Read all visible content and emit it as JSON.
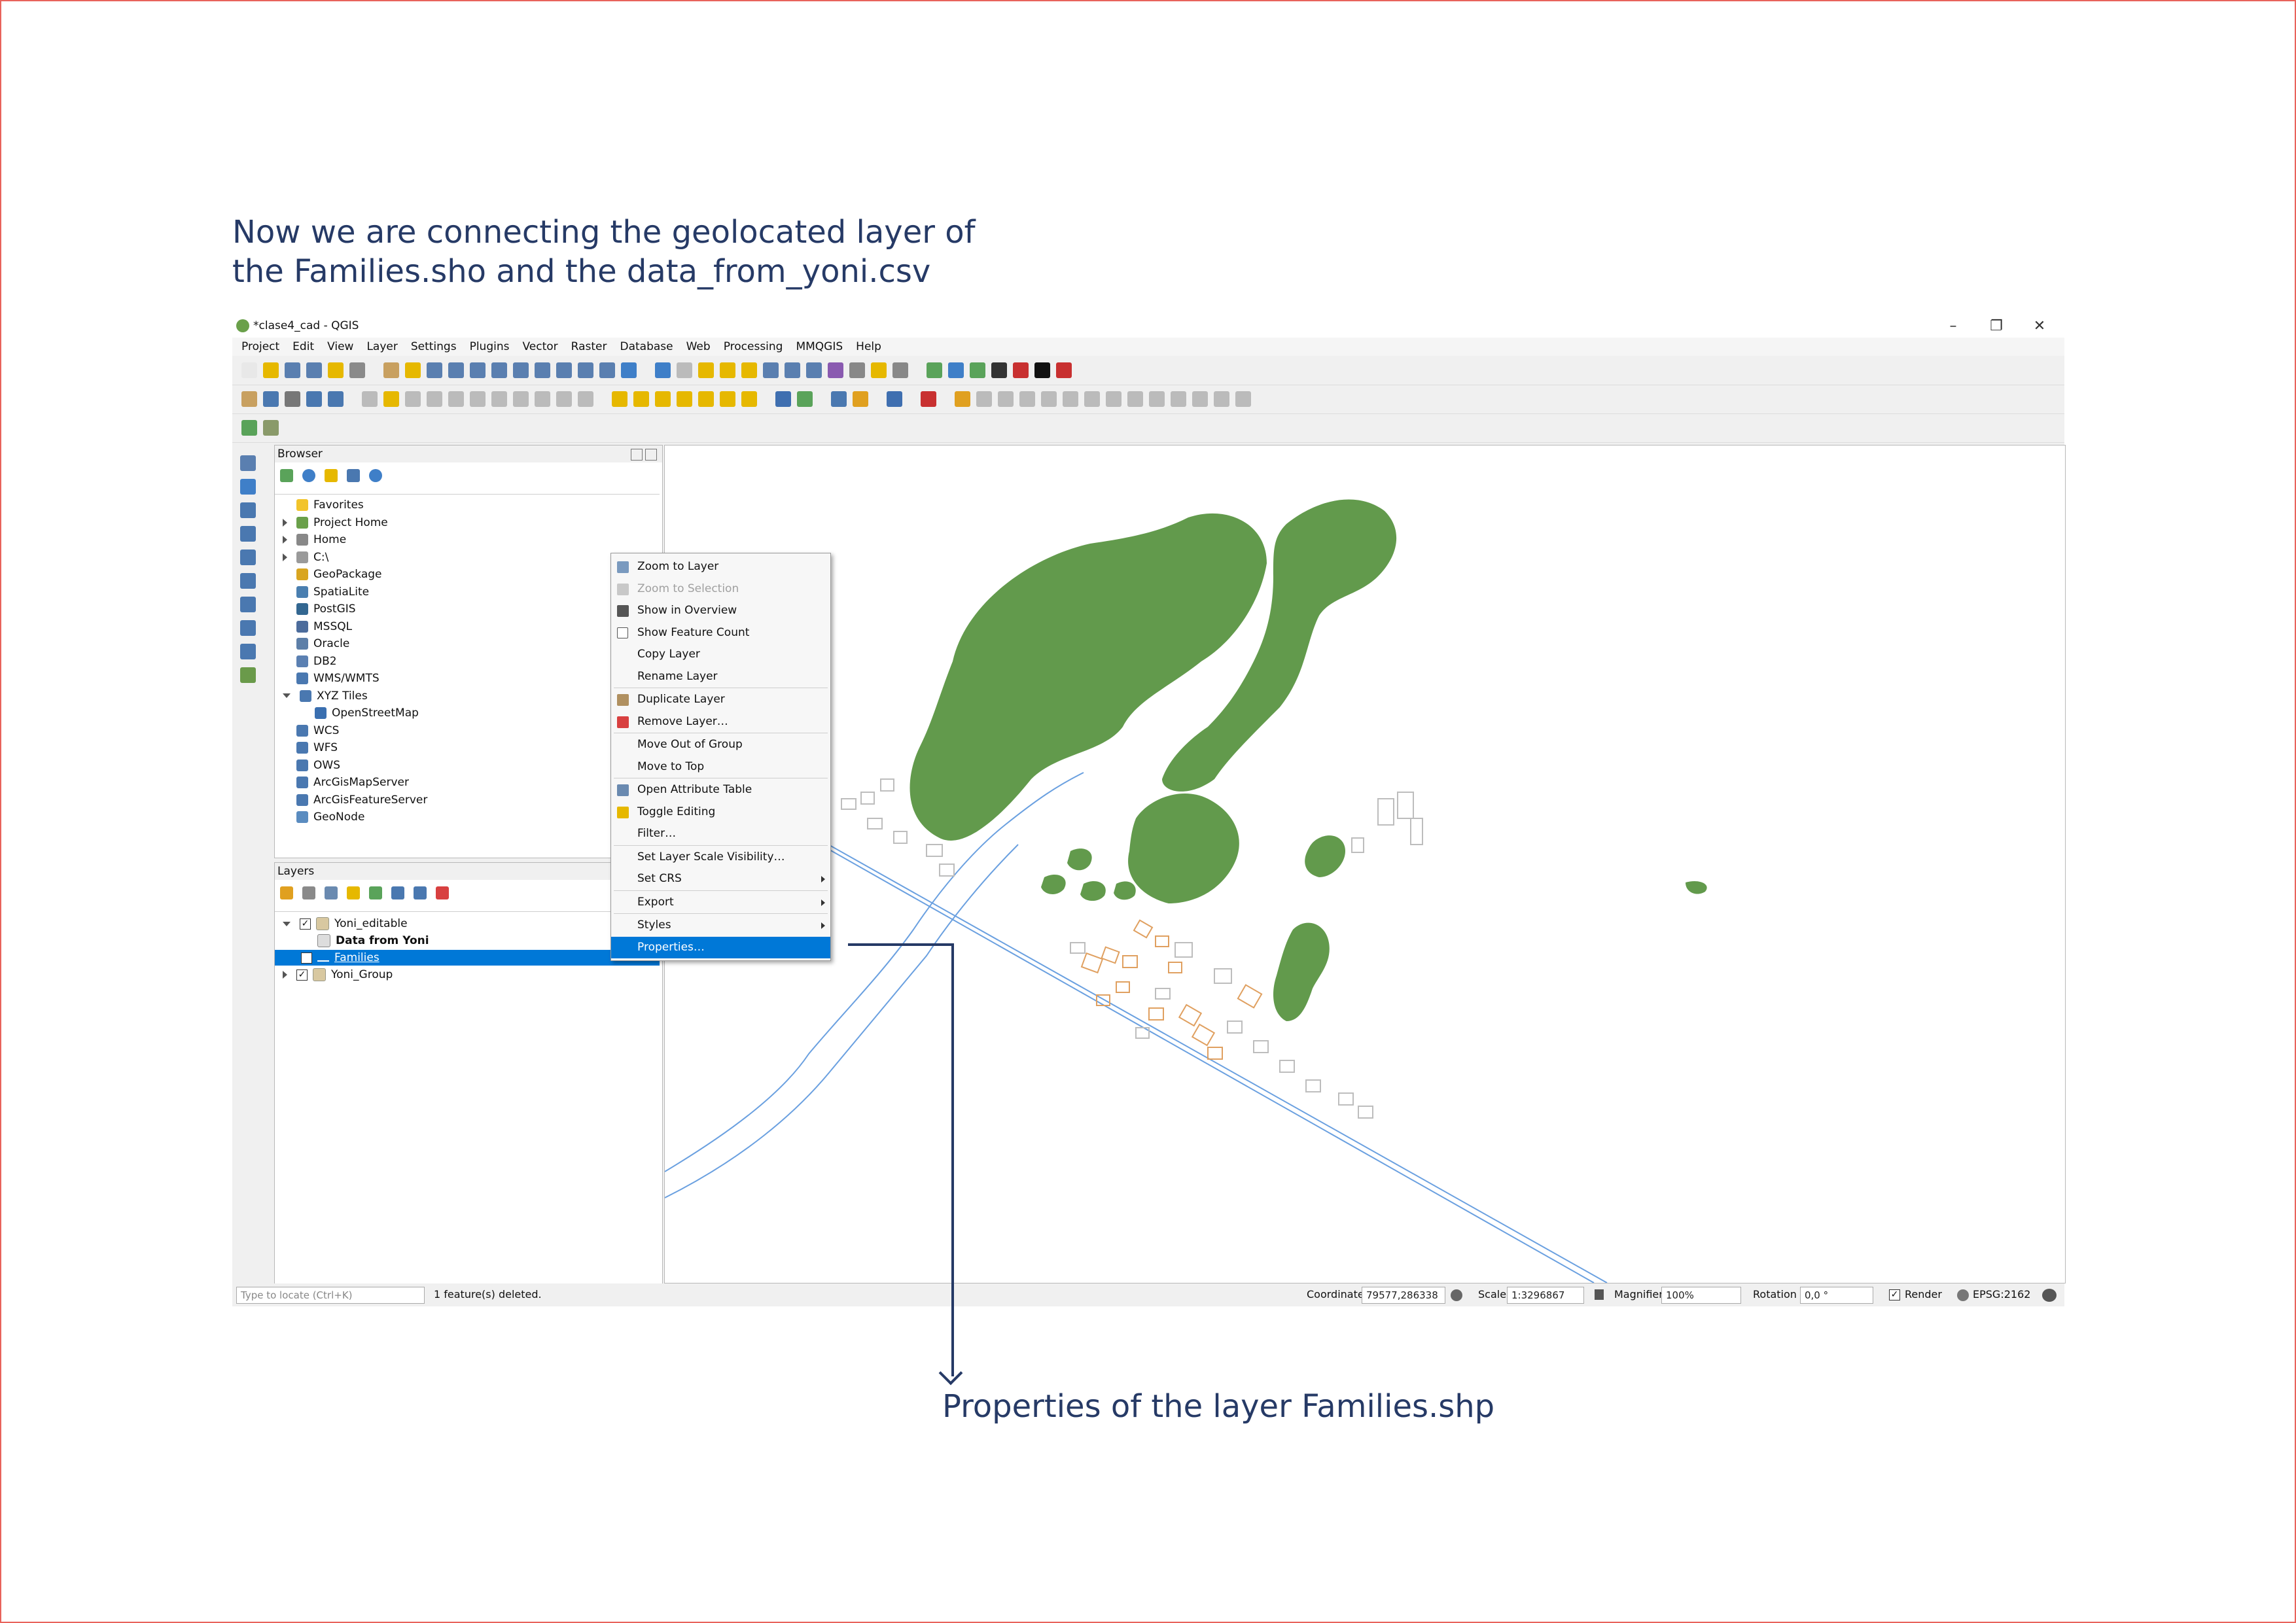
{
  "captions": {
    "top_line1": "Now we are connecting the geolocated layer of",
    "top_line2": "the Families.sho and the data_from_yoni.csv",
    "bottom": "Properties of the layer Families.shp"
  },
  "window": {
    "title": "*clase4_cad - QGIS",
    "minimize": "–",
    "restore": "❐",
    "close": "✕"
  },
  "menu": [
    "Project",
    "Edit",
    "View",
    "Layer",
    "Settings",
    "Plugins",
    "Vector",
    "Raster",
    "Database",
    "Web",
    "Processing",
    "MMQGIS",
    "Help"
  ],
  "browser": {
    "title": "Browser",
    "items": [
      {
        "label": "Favorites",
        "icon": "star-icon",
        "color": "#f2c42b",
        "arrow": "none",
        "indent": 0
      },
      {
        "label": "Project Home",
        "icon": "project-home-icon",
        "color": "#6aa04a",
        "arrow": "right",
        "indent": 0
      },
      {
        "label": "Home",
        "icon": "home-folder-icon",
        "color": "#888888",
        "arrow": "right",
        "indent": 0
      },
      {
        "label": "C:\\",
        "icon": "drive-icon",
        "color": "#9a9a9a",
        "arrow": "right",
        "indent": 0
      },
      {
        "label": "GeoPackage",
        "icon": "geopackage-icon",
        "color": "#d9a520",
        "arrow": "none",
        "indent": 0
      },
      {
        "label": "SpatiaLite",
        "icon": "spatialite-icon",
        "color": "#4a7fb0",
        "arrow": "none",
        "indent": 0
      },
      {
        "label": "PostGIS",
        "icon": "postgis-icon",
        "color": "#336791",
        "arrow": "none",
        "indent": 0
      },
      {
        "label": "MSSQL",
        "icon": "mssql-icon",
        "color": "#4c6c9c",
        "arrow": "none",
        "indent": 0
      },
      {
        "label": "Oracle",
        "icon": "oracle-icon",
        "color": "#5d7fa8",
        "arrow": "none",
        "indent": 0
      },
      {
        "label": "DB2",
        "icon": "db2-icon",
        "color": "#5b80b2",
        "arrow": "none",
        "indent": 0
      },
      {
        "label": "WMS/WMTS",
        "icon": "wms-globe-icon",
        "color": "#4a78b0",
        "arrow": "none",
        "indent": 0
      },
      {
        "label": "XYZ Tiles",
        "icon": "xyz-globe-icon",
        "color": "#4a78b0",
        "arrow": "down",
        "indent": 0
      },
      {
        "label": "OpenStreetMap",
        "icon": "tile-icon",
        "color": "#3a6fb0",
        "arrow": "none",
        "indent": 1
      },
      {
        "label": "WCS",
        "icon": "wcs-globe-icon",
        "color": "#4a78b0",
        "arrow": "none",
        "indent": 0
      },
      {
        "label": "WFS",
        "icon": "wfs-globe-icon",
        "color": "#4a78b0",
        "arrow": "none",
        "indent": 0
      },
      {
        "label": "OWS",
        "icon": "ows-globe-icon",
        "color": "#4a78b0",
        "arrow": "none",
        "indent": 0
      },
      {
        "label": "ArcGisMapServer",
        "icon": "arcgis-map-icon",
        "color": "#4a78b0",
        "arrow": "none",
        "indent": 0
      },
      {
        "label": "ArcGisFeatureServer",
        "icon": "arcgis-feature-icon",
        "color": "#4a78b0",
        "arrow": "none",
        "indent": 0
      },
      {
        "label": "GeoNode",
        "icon": "geonode-icon",
        "color": "#5a8cc0",
        "arrow": "none",
        "indent": 0
      }
    ]
  },
  "layers": {
    "title": "Layers",
    "items": [
      {
        "label": "Yoni_editable",
        "checked": true,
        "arrow": "down",
        "indent": 0,
        "bold": false,
        "selected": false
      },
      {
        "label": "Data from Yoni",
        "checked": null,
        "arrow": "none",
        "indent": 1,
        "bold": true,
        "selected": false
      },
      {
        "label": "Families",
        "checked": true,
        "arrow": "none",
        "indent": 1,
        "bold": false,
        "selected": true
      },
      {
        "label": "Yoni_Group",
        "checked": true,
        "arrow": "right",
        "indent": 0,
        "bold": false,
        "selected": false
      }
    ]
  },
  "context_menu": [
    {
      "label": "Zoom to Layer",
      "icon": "zoom-layer-icon",
      "disabled": false,
      "submenu": false,
      "sep_before": false
    },
    {
      "label": "Zoom to Selection",
      "icon": "zoom-selection-icon",
      "disabled": true,
      "submenu": false,
      "sep_before": false
    },
    {
      "label": "Show in Overview",
      "icon": "overview-icon",
      "disabled": false,
      "submenu": false,
      "sep_before": false
    },
    {
      "label": "Show Feature Count",
      "icon": "checkbox-icon",
      "disabled": false,
      "submenu": false,
      "sep_before": false
    },
    {
      "label": "Copy Layer",
      "icon": "",
      "disabled": false,
      "submenu": false,
      "sep_before": false
    },
    {
      "label": "Rename Layer",
      "icon": "",
      "disabled": false,
      "submenu": false,
      "sep_before": false
    },
    {
      "label": "Duplicate Layer",
      "icon": "duplicate-icon",
      "disabled": false,
      "submenu": false,
      "sep_before": true
    },
    {
      "label": "Remove Layer…",
      "icon": "remove-layer-icon",
      "disabled": false,
      "submenu": false,
      "sep_before": false
    },
    {
      "label": "Move Out of Group",
      "icon": "",
      "disabled": false,
      "submenu": false,
      "sep_before": true
    },
    {
      "label": "Move to Top",
      "icon": "",
      "disabled": false,
      "submenu": false,
      "sep_before": false
    },
    {
      "label": "Open Attribute Table",
      "icon": "attribute-table-icon",
      "disabled": false,
      "submenu": false,
      "sep_before": true
    },
    {
      "label": "Toggle Editing",
      "icon": "pencil-icon",
      "disabled": false,
      "submenu": false,
      "sep_before": false
    },
    {
      "label": "Filter…",
      "icon": "",
      "disabled": false,
      "submenu": false,
      "sep_before": false
    },
    {
      "label": "Set Layer Scale Visibility…",
      "icon": "",
      "disabled": false,
      "submenu": false,
      "sep_before": true
    },
    {
      "label": "Set CRS",
      "icon": "",
      "disabled": false,
      "submenu": true,
      "sep_before": false
    },
    {
      "label": "Export",
      "icon": "",
      "disabled": false,
      "submenu": true,
      "sep_before": true
    },
    {
      "label": "Styles",
      "icon": "",
      "disabled": false,
      "submenu": true,
      "sep_before": true
    },
    {
      "label": "Properties…",
      "icon": "",
      "disabled": false,
      "submenu": false,
      "sep_before": false,
      "highlighted": true
    }
  ],
  "status": {
    "locate_placeholder": "Type to locate (Ctrl+K)",
    "message": "1 feature(s) deleted.",
    "coordinate_label": "Coordinate",
    "coordinate_value": "79577,286338",
    "scale_label": "Scale",
    "scale_value": "1:3296867",
    "magnifier_label": "Magnifier",
    "magnifier_value": "100%",
    "rotation_label": "Rotation",
    "rotation_value": "0,0 °",
    "render_label": "Render",
    "crs": "EPSG:2162"
  },
  "colors": {
    "accent": "#0078d7",
    "annotation": "#263a66",
    "polygons": "#629a4c",
    "buildings_selected": "#e0a060",
    "roads": "#6aa0e0",
    "frame": "#e8635c"
  }
}
